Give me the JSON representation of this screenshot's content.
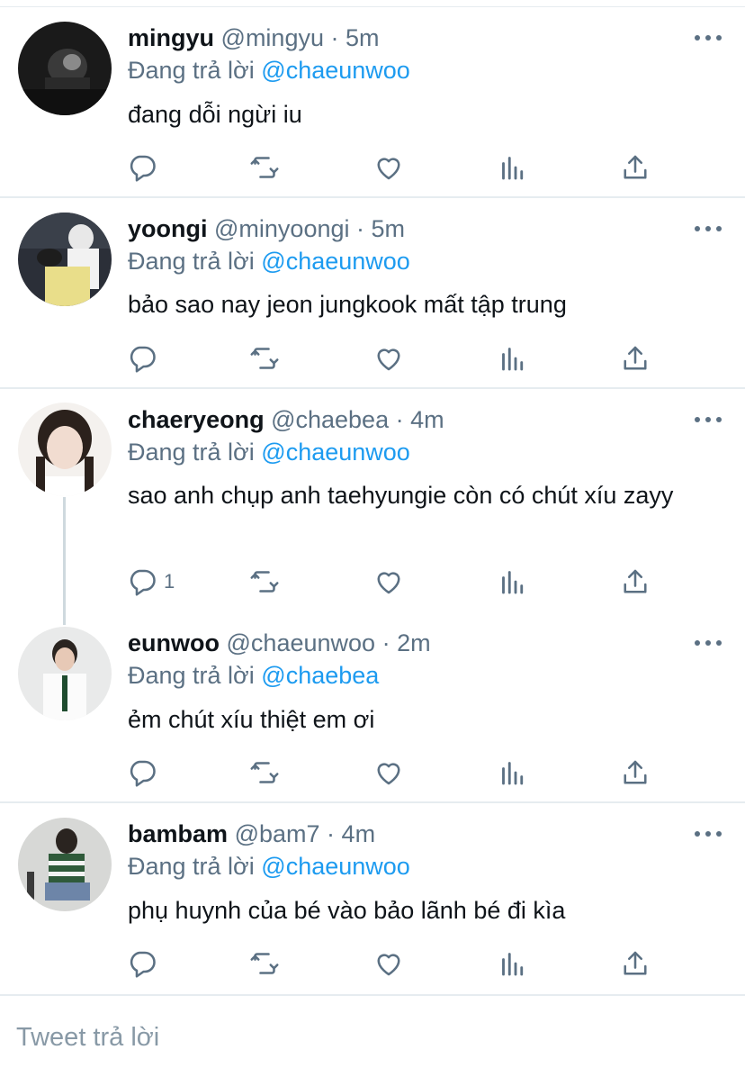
{
  "reply_prefix": "Đang trả lời",
  "tweets": [
    {
      "name": "mingyu",
      "handle": "@mingyu",
      "sep": "·",
      "time": "5m",
      "reply_to": "@chaeunwoo",
      "text": "đang dỗi ngừi iu",
      "reply_count": ""
    },
    {
      "name": "yoongi",
      "handle": "@minyoongi",
      "sep": "·",
      "time": "5m",
      "reply_to": "@chaeunwoo",
      "text": "bảo sao nay jeon jungkook mất tập trung",
      "reply_count": ""
    },
    {
      "name": "chaeryeong",
      "handle": "@chaebea",
      "sep": "·",
      "time": "4m",
      "reply_to": "@chaeunwoo",
      "text": "sao anh chụp anh taehyungie còn có chút xíu zayy",
      "reply_count": "1"
    },
    {
      "name": "eunwoo",
      "handle": "@chaeunwoo",
      "sep": "·",
      "time": "2m",
      "reply_to": "@chaebea",
      "text": "ẻm chút xíu thiệt em ơi",
      "reply_count": ""
    },
    {
      "name": "bambam",
      "handle": "@bam7",
      "sep": "·",
      "time": "4m",
      "reply_to": "@chaeunwoo",
      "text": "phụ huynh của bé vào bảo lãnh bé đi kìa",
      "reply_count": ""
    }
  ],
  "composer": {
    "placeholder": "Tweet trả lời"
  },
  "colors": {
    "link": "#1d9bf0",
    "secondary": "#5b7083",
    "divider": "#e6ecf0"
  },
  "icons": [
    "reply-icon",
    "retweet-icon",
    "like-icon",
    "analytics-icon",
    "share-icon",
    "more-icon"
  ]
}
